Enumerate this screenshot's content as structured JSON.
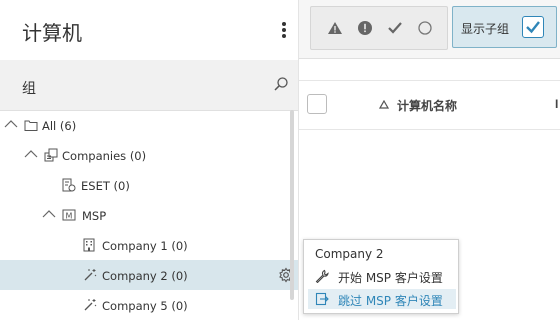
{
  "sidebar": {
    "title": "计算机",
    "group_label": "组"
  },
  "tree": [
    {
      "label": "All (6)",
      "expanded": true,
      "icon": "folder-icon"
    },
    {
      "label": "Companies (0)",
      "expanded": true,
      "icon": "companies-icon"
    },
    {
      "label": "ESET (0)",
      "icon": "company-gear-icon"
    },
    {
      "label": "MSP",
      "expanded": true,
      "icon": "msp-icon"
    },
    {
      "label": "Company 1 (0)",
      "icon": "building-icon"
    },
    {
      "label": "Company 2 (0)",
      "icon": "wand-icon",
      "selected": true
    },
    {
      "label": "Company 5 (0)",
      "icon": "wand-icon"
    }
  ],
  "toolbar": {
    "filter_icons": [
      "warning-icon",
      "error-icon",
      "check-icon",
      "circle-icon"
    ],
    "show_subgroups_label": "显示子组",
    "show_subgroups_checked": true
  },
  "table": {
    "column_name": "计算机名称",
    "next_column_partial": "I"
  },
  "context_menu": {
    "header": "Company 2",
    "items": [
      {
        "label": "开始 MSP 客户设置",
        "icon": "wrench-icon"
      },
      {
        "label": "跳过 MSP 客户设置",
        "icon": "skip-icon",
        "highlighted": true
      }
    ]
  },
  "colors": {
    "accent": "#2f86b8",
    "selected_row": "#d8e6ec",
    "toolbar_bg": "#f6f6f6"
  }
}
